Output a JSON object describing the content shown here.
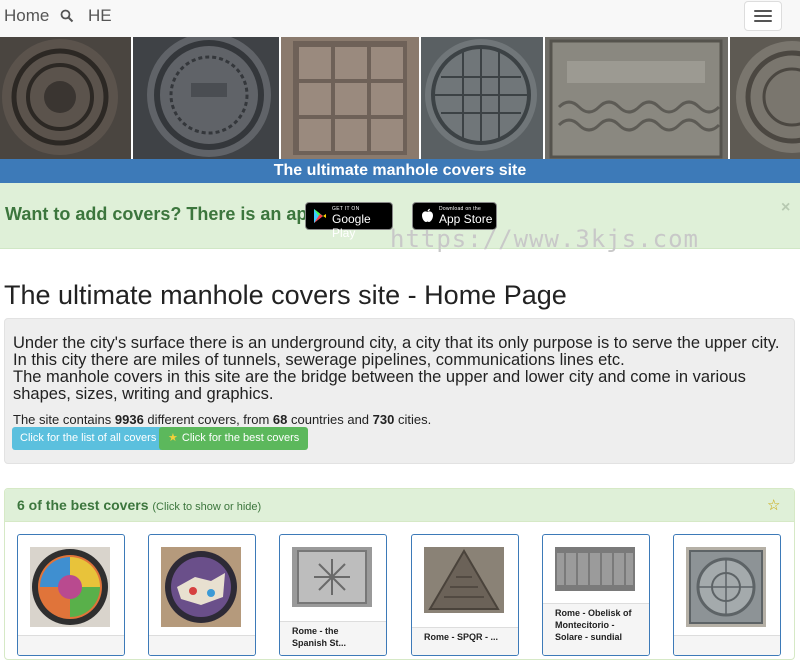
{
  "nav": {
    "home": "Home",
    "lang": "HE"
  },
  "banner": {
    "title": "The ultimate manhole covers site",
    "tiles": [
      {
        "name": "banner-photo-1",
        "base": "#4a4540",
        "ring": "#2c2824"
      },
      {
        "name": "banner-photo-2",
        "base": "#55575b",
        "ring": "#33363a"
      },
      {
        "name": "banner-photo-3",
        "base": "#7c6e63",
        "ring": "#a89a8f"
      },
      {
        "name": "banner-photo-4",
        "base": "#646a6d",
        "ring": "#3c4245"
      },
      {
        "name": "banner-photo-5",
        "base": "#85837c",
        "ring": "#5d5b55"
      },
      {
        "name": "banner-photo-6",
        "base": "#6e6a62",
        "ring": "#4b4741"
      }
    ]
  },
  "app_alert": {
    "text": "Want to add covers? There is an app!",
    "google_small": "GET IT ON",
    "google_big": "Google Play",
    "apple_small": "Download on the",
    "apple_big": "App Store",
    "close": "×"
  },
  "watermark": {
    "url": "https://www.3kjs.com"
  },
  "page": {
    "title": "The ultimate manhole covers site - Home Page"
  },
  "intro": {
    "line1": "Under the city's surface there is an underground city, a city that its only purpose is to serve the upper city. In this city there are miles of tunnels, sewerage pipelines, communications lines etc.",
    "line2": "The manhole covers in this site are the bridge between the upper and lower city and come in various shapes, sizes, writing and graphics.",
    "stats_prefix": "The site contains ",
    "covers_count": "9936",
    "stats_mid1": " different covers, from ",
    "countries_count": "68",
    "stats_mid2": " countries and ",
    "cities_count": "730",
    "stats_suffix": " cities.",
    "all_covers_btn": "Click for the list of all covers",
    "best_covers_btn": "Click for the best covers"
  },
  "best": {
    "title": "6 of the best covers",
    "hint": "(Click to show or hide)",
    "cards": [
      {
        "caption": "",
        "tone": "#3b3b3b"
      },
      {
        "caption": "",
        "tone": "#5a4a3a"
      },
      {
        "caption": "Rome - the Spanish St...",
        "tone": "#8f8f8f"
      },
      {
        "caption": "Rome - SPQR - ...",
        "tone": "#6b6258"
      },
      {
        "caption": "Rome - Obelisk of Montecitorio - Solare - sundial",
        "tone": "#7a7a7a"
      },
      {
        "caption": "",
        "tone": "#9aa0a2"
      }
    ]
  },
  "colors": {
    "banner_blue": "#3d7ab8",
    "alert_green": "#dff0d8",
    "btn_info": "#5bc0de",
    "btn_success": "#5cb85c"
  }
}
